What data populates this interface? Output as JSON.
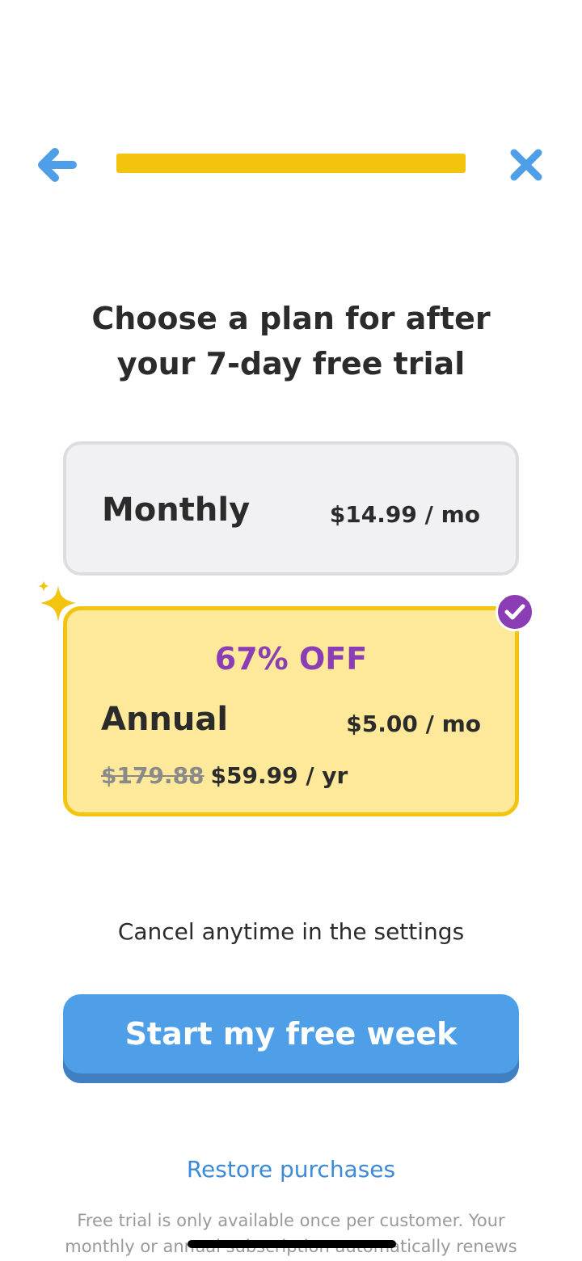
{
  "nav": {
    "back_icon": "arrow-left-icon",
    "close_icon": "close-icon",
    "progress": 1.0,
    "accent_color": "#4f9fe8",
    "progress_color": "#f2c40e"
  },
  "heading": "Choose a plan for after\nyour 7-day free trial",
  "plans": {
    "monthly": {
      "name": "Monthly",
      "price": "$14.99 / mo",
      "selected": false
    },
    "annual": {
      "discount": "67% OFF",
      "name": "Annual",
      "price": "$5.00 / mo",
      "old_price": "$179.88",
      "yearly_price": "$59.99 / yr",
      "selected": true,
      "highlight_color": "#fde999",
      "badge_color": "#8a3db5"
    }
  },
  "cancel_note": "Cancel anytime in the settings",
  "cta_label": "Start my free week",
  "restore_label": "Restore purchases",
  "fineprint": "Free trial is only available once per customer. Your monthly or annual subscription automatically renews"
}
